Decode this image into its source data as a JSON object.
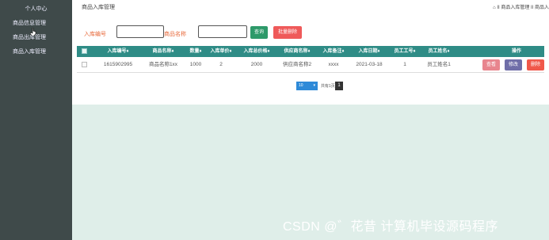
{
  "sidebar": {
    "items": [
      {
        "label": "个人中心"
      },
      {
        "label": "商品信息管理"
      },
      {
        "label": "商品出库管理"
      },
      {
        "label": "商品入库管理"
      }
    ]
  },
  "header": {
    "title": "商品入库管理",
    "breadcrumb": "⌂ II 商品入库管理 II 商品入"
  },
  "search": {
    "field1_label": "入库编号",
    "field1_value": "",
    "field2_label": "商品名称",
    "field2_value": "",
    "query_label": "查询",
    "batch_delete_label": "批量删除"
  },
  "table": {
    "columns": [
      "入库编号♦",
      "商品名称♦",
      "数量♦",
      "入库单价♦",
      "入库总价格♦",
      "供应商名称♦",
      "入库备注♦",
      "入库日期♦",
      "员工工号♦",
      "员工姓名♦",
      "操作"
    ],
    "rows": [
      {
        "code": "1615902995",
        "name": "商品名称1xx",
        "qty": "1000",
        "price": "2",
        "total": "2000",
        "supplier": "供应商名称2",
        "note": "xxxx",
        "date": "2021-03-18",
        "emp_no": "1",
        "emp_name": "员工姓名1"
      }
    ],
    "actions": {
      "view": "查看",
      "edit": "修改",
      "delete": "删除"
    }
  },
  "pager": {
    "page_size": "10",
    "total_text": "共有1页",
    "current_page": "1"
  },
  "colors": {
    "sidebar_bg": "#3f4a4a",
    "header_bg": "#2f8c86",
    "query_btn": "#2e9a6a",
    "batch_delete_btn": "#ef5a5a",
    "view_btn": "#e8858e",
    "edit_btn": "#6f6ea8",
    "delete_btn": "#f0584a",
    "content_bg": "#dfeee9"
  },
  "watermark": "CSDN @゛花昔  计算机毕设源码程序"
}
